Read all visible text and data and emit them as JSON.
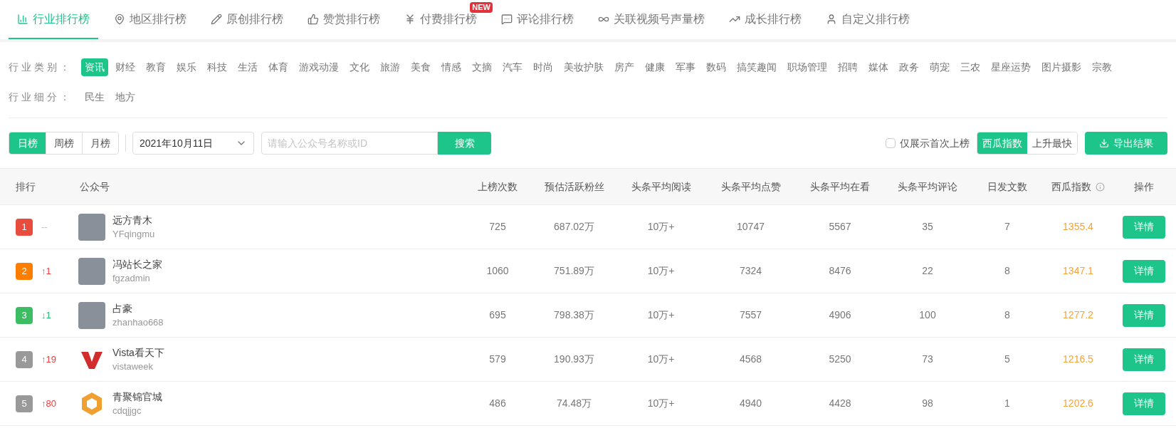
{
  "tabs": [
    {
      "label": "行业排行榜",
      "selected": true
    },
    {
      "label": "地区排行榜",
      "selected": false
    },
    {
      "label": "原创排行榜",
      "selected": false
    },
    {
      "label": "赞赏排行榜",
      "selected": false
    },
    {
      "label": "付费排行榜",
      "selected": false,
      "badge": "NEW"
    },
    {
      "label": "评论排行榜",
      "selected": false
    },
    {
      "label": "关联视频号声量榜",
      "selected": false
    },
    {
      "label": "成长排行榜",
      "selected": false
    },
    {
      "label": "自定义排行榜",
      "selected": false
    }
  ],
  "filters": [
    {
      "label": "行 业 类 别 ：",
      "options": [
        {
          "label": "资讯",
          "selected": true
        },
        {
          "label": "财经",
          "selected": false
        },
        {
          "label": "教育",
          "selected": false
        },
        {
          "label": "娱乐",
          "selected": false
        },
        {
          "label": "科技",
          "selected": false
        },
        {
          "label": "生活",
          "selected": false
        },
        {
          "label": "体育",
          "selected": false
        },
        {
          "label": "游戏动漫",
          "selected": false
        },
        {
          "label": "文化",
          "selected": false
        },
        {
          "label": "旅游",
          "selected": false
        },
        {
          "label": "美食",
          "selected": false
        },
        {
          "label": "情感",
          "selected": false
        },
        {
          "label": "文摘",
          "selected": false
        },
        {
          "label": "汽车",
          "selected": false
        },
        {
          "label": "时尚",
          "selected": false
        },
        {
          "label": "美妆护肤",
          "selected": false
        },
        {
          "label": "房产",
          "selected": false
        },
        {
          "label": "健康",
          "selected": false
        },
        {
          "label": "军事",
          "selected": false
        },
        {
          "label": "数码",
          "selected": false
        },
        {
          "label": "搞笑趣闻",
          "selected": false
        },
        {
          "label": "职场管理",
          "selected": false
        },
        {
          "label": "招聘",
          "selected": false
        },
        {
          "label": "媒体",
          "selected": false
        },
        {
          "label": "政务",
          "selected": false
        },
        {
          "label": "萌宠",
          "selected": false
        },
        {
          "label": "三农",
          "selected": false
        },
        {
          "label": "星座运势",
          "selected": false
        },
        {
          "label": "图片摄影",
          "selected": false
        },
        {
          "label": "宗教",
          "selected": false
        }
      ]
    },
    {
      "label": "行 业 细 分 ：",
      "options": [
        {
          "label": "民生",
          "selected": false
        },
        {
          "label": "地方",
          "selected": false
        }
      ]
    }
  ],
  "toolbar": {
    "periods": [
      {
        "label": "日榜",
        "selected": true
      },
      {
        "label": "周榜",
        "selected": false
      },
      {
        "label": "月榜",
        "selected": false
      }
    ],
    "date": "2021年10月11日",
    "search": {
      "placeholder": "请输入公众号名称或ID"
    },
    "search_button": "搜索",
    "first_only": {
      "label": "仅展示首次上榜",
      "checked": false
    },
    "sorts": [
      {
        "label": "西瓜指数",
        "selected": true
      },
      {
        "label": "上升最快",
        "selected": false
      }
    ],
    "export_button": "导出结果"
  },
  "table": {
    "columns": [
      "排行",
      "公众号",
      "上榜次数",
      "预估活跃粉丝",
      "头条平均阅读",
      "头条平均点赞",
      "头条平均在看",
      "头条平均评论",
      "日发文数",
      "西瓜指数",
      "操作"
    ],
    "rows": [
      {
        "cells": [
          {
            "rank": "1",
            "color": "#e74c3c",
            "change": {
              "kind": "none",
              "text": "--"
            }
          },
          {
            "avatar": {
              "kind": "photo"
            },
            "name": "远方青木",
            "id": "YFqingmu"
          },
          "725",
          "687.02万",
          "10万+",
          "10747",
          "5567",
          "35",
          "7",
          "1355.4",
          "详情"
        ]
      },
      {
        "cells": [
          {
            "rank": "2",
            "color": "#ff7e00",
            "change": {
              "kind": "up",
              "text": "↑1"
            }
          },
          {
            "avatar": {
              "kind": "photo"
            },
            "name": "冯站长之家",
            "id": "fgzadmin"
          },
          "1060",
          "751.89万",
          "10万+",
          "7324",
          "8476",
          "22",
          "8",
          "1347.1",
          "详情"
        ]
      },
      {
        "cells": [
          {
            "rank": "3",
            "color": "#3cbc63",
            "change": {
              "kind": "down",
              "text": "↓1"
            }
          },
          {
            "avatar": {
              "kind": "photo"
            },
            "name": "占豪",
            "id": "zhanhao668"
          },
          "695",
          "798.38万",
          "10万+",
          "7557",
          "4906",
          "100",
          "8",
          "1277.2",
          "详情"
        ]
      },
      {
        "cells": [
          {
            "rank": "4",
            "color": "#999999",
            "change": {
              "kind": "up",
              "text": "↑19"
            }
          },
          {
            "avatar": {
              "kind": "v-logo"
            },
            "name": "Vista看天下",
            "id": "vistaweek"
          },
          "579",
          "190.93万",
          "10万+",
          "4568",
          "5250",
          "73",
          "5",
          "1216.5",
          "详情"
        ]
      },
      {
        "cells": [
          {
            "rank": "5",
            "color": "#999999",
            "change": {
              "kind": "up",
              "text": "↑80"
            }
          },
          {
            "avatar": {
              "kind": "hex-logo"
            },
            "name": "青聚锦官城",
            "id": "cdqjjgc"
          },
          "486",
          "74.48万",
          "10万+",
          "4940",
          "4428",
          "98",
          "1",
          "1202.6",
          "详情"
        ]
      }
    ]
  }
}
